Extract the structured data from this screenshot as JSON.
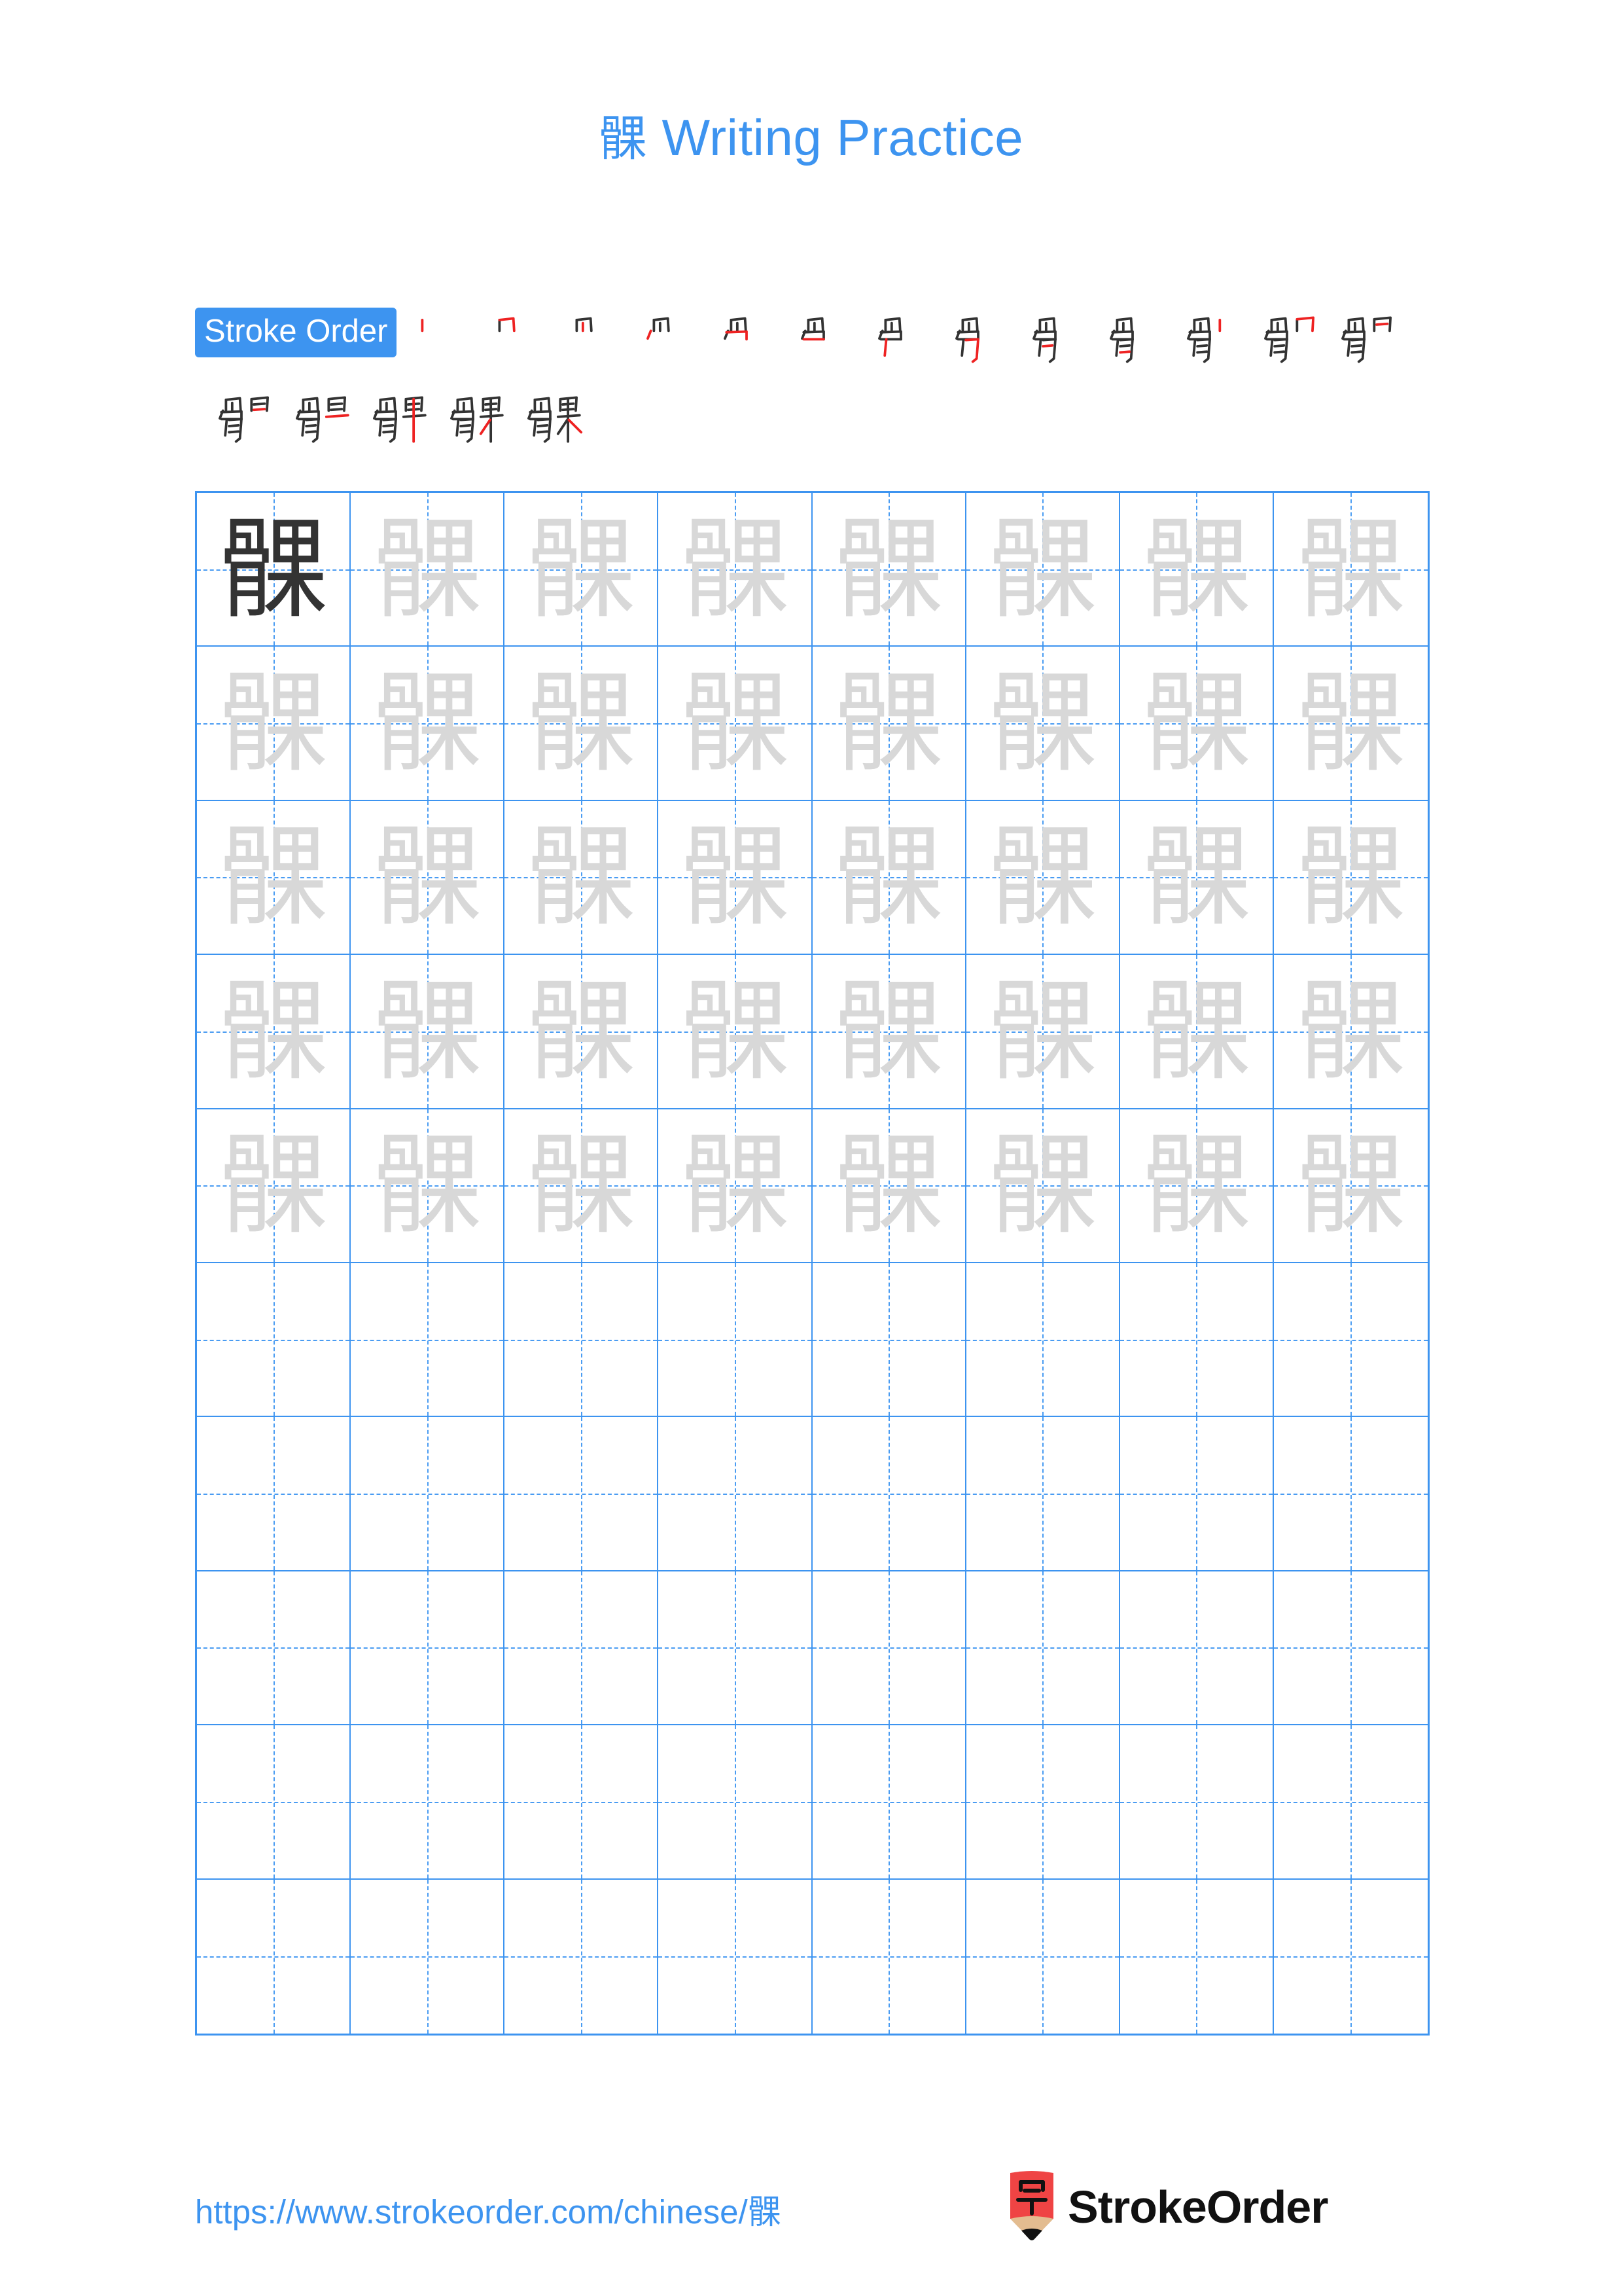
{
  "page": {
    "character": "髁",
    "title_suffix": " Writing Practice",
    "title_full": "髁 Writing Practice",
    "accent_color": "#3d94f0",
    "stroke_new_color": "#ee2222",
    "stroke_done_color": "#333333",
    "trace_color": "#d8d8d8"
  },
  "stroke_order": {
    "badge_label": "Stroke Order",
    "total_strokes": 18,
    "row1_count": 13,
    "row2_count": 5,
    "steps": [
      {
        "index": 1,
        "glyph": "丨"
      },
      {
        "index": 2,
        "glyph": "冂"
      },
      {
        "index": 3,
        "glyph": "冋"
      },
      {
        "index": 4,
        "glyph": "冎"
      },
      {
        "index": 5,
        "glyph": "咼"
      },
      {
        "index": 6,
        "glyph": "咼"
      },
      {
        "index": 7,
        "glyph": "骨"
      },
      {
        "index": 8,
        "glyph": "骨"
      },
      {
        "index": 9,
        "glyph": "骨"
      },
      {
        "index": 10,
        "glyph": "骨"
      },
      {
        "index": 11,
        "glyph": "骨"
      },
      {
        "index": 12,
        "glyph": "骨"
      },
      {
        "index": 13,
        "glyph": "骨"
      },
      {
        "index": 14,
        "glyph": "骭"
      },
      {
        "index": 15,
        "glyph": "骯"
      },
      {
        "index": 16,
        "glyph": "骿"
      },
      {
        "index": 17,
        "glyph": "髁"
      },
      {
        "index": 18,
        "glyph": "髁"
      }
    ]
  },
  "practice_grid": {
    "columns": 8,
    "rows": 10,
    "filled_rows": 5,
    "empty_rows": 5,
    "model_cell": {
      "row": 1,
      "column": 1,
      "glyph": "髁",
      "style": "dark"
    },
    "trace_glyph": "髁"
  },
  "footer": {
    "url": "https://www.strokeorder.com/chinese/髁",
    "logo_char": "字",
    "logo_text": "StrokeOrder",
    "logo_body_color": "#ef4444",
    "logo_tip_color": "#e3bc90"
  }
}
